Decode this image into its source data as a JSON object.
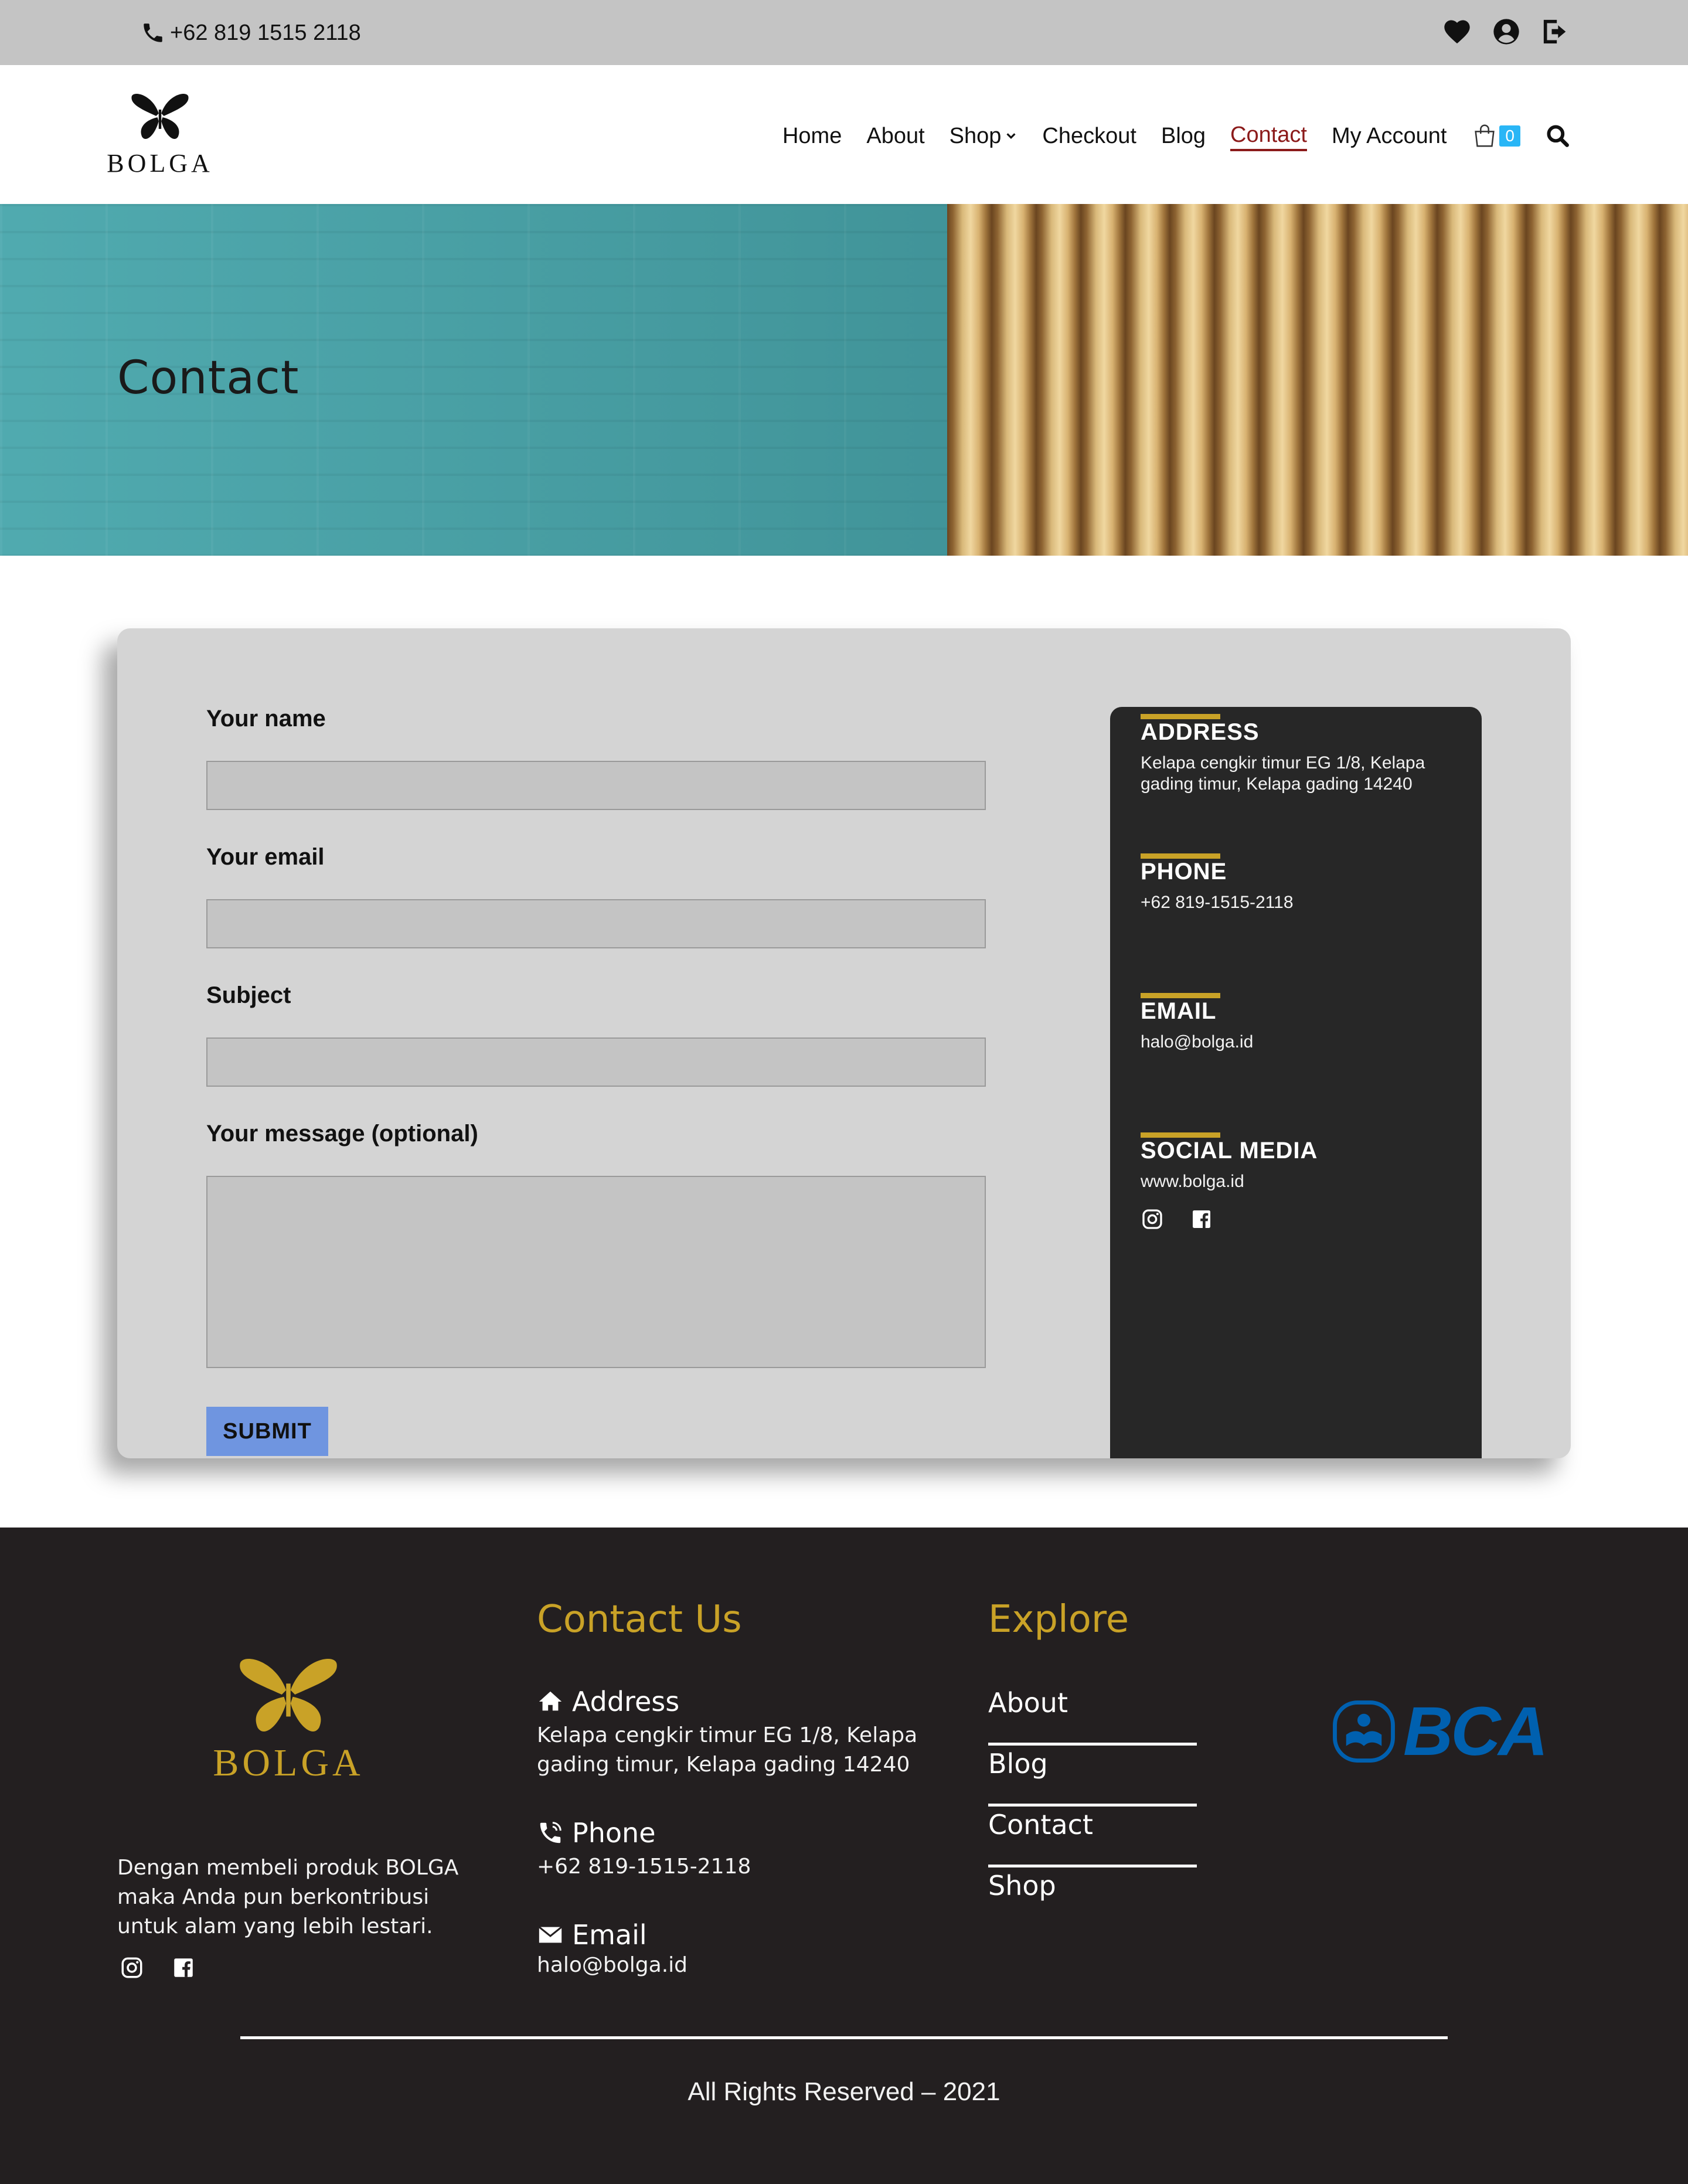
{
  "topbar": {
    "phone": "+62 819 1515 2118",
    "icons": [
      "heart-icon",
      "user-icon",
      "logout-icon"
    ]
  },
  "header": {
    "logo_text": "BOLGA",
    "nav": [
      {
        "label": "Home"
      },
      {
        "label": "About"
      },
      {
        "label": "Shop"
      },
      {
        "label": "Checkout"
      },
      {
        "label": "Blog"
      },
      {
        "label": "Contact",
        "active": true
      },
      {
        "label": "My Account"
      }
    ],
    "cart_count": "0"
  },
  "hero": {
    "title": "Contact"
  },
  "form": {
    "name_label": "Your name",
    "email_label": "Your email",
    "subject_label": "Subject",
    "message_label": "Your message (optional)",
    "name_value": "",
    "email_value": "",
    "subject_value": "",
    "message_value": "",
    "submit_label": "SUBMIT"
  },
  "info": {
    "address_heading": "ADDRESS",
    "address_text": "Kelapa cengkir timur EG 1/8, Kelapa gading timur, Kelapa gading 14240",
    "phone_heading": "PHONE",
    "phone_text": "+62 819-1515-2118",
    "email_heading": "EMAIL",
    "email_text": "halo@bolga.id",
    "social_heading": "SOCIAL MEDIA",
    "social_text": "www.bolga.id"
  },
  "footer": {
    "logo_text": "BOLGA",
    "about": "Dengan membeli produk BOLGA maka Anda pun berkontribusi untuk alam yang lebih lestari.",
    "contact_title": "Contact Us",
    "address_label": "Address",
    "address_text": "Kelapa cengkir timur EG 1/8, Kelapa gading timur, Kelapa gading 14240",
    "phone_label": "Phone",
    "phone_text": "+62 819-1515-2118",
    "email_label": "Email",
    "email_text": "halo@bolga.id",
    "explore_title": "Explore",
    "explore_links": [
      "About",
      "Blog",
      "Contact",
      "Shop"
    ],
    "bank_text": "BCA",
    "copyright": "All Rights Reserved – 2021"
  },
  "colors": {
    "accent_gold": "#c9a227",
    "nav_active": "#8b1a1a",
    "submit": "#6f95e0",
    "footer_bg": "#231f20",
    "cart_badge": "#29b6f6",
    "bca_blue": "#0060af"
  }
}
